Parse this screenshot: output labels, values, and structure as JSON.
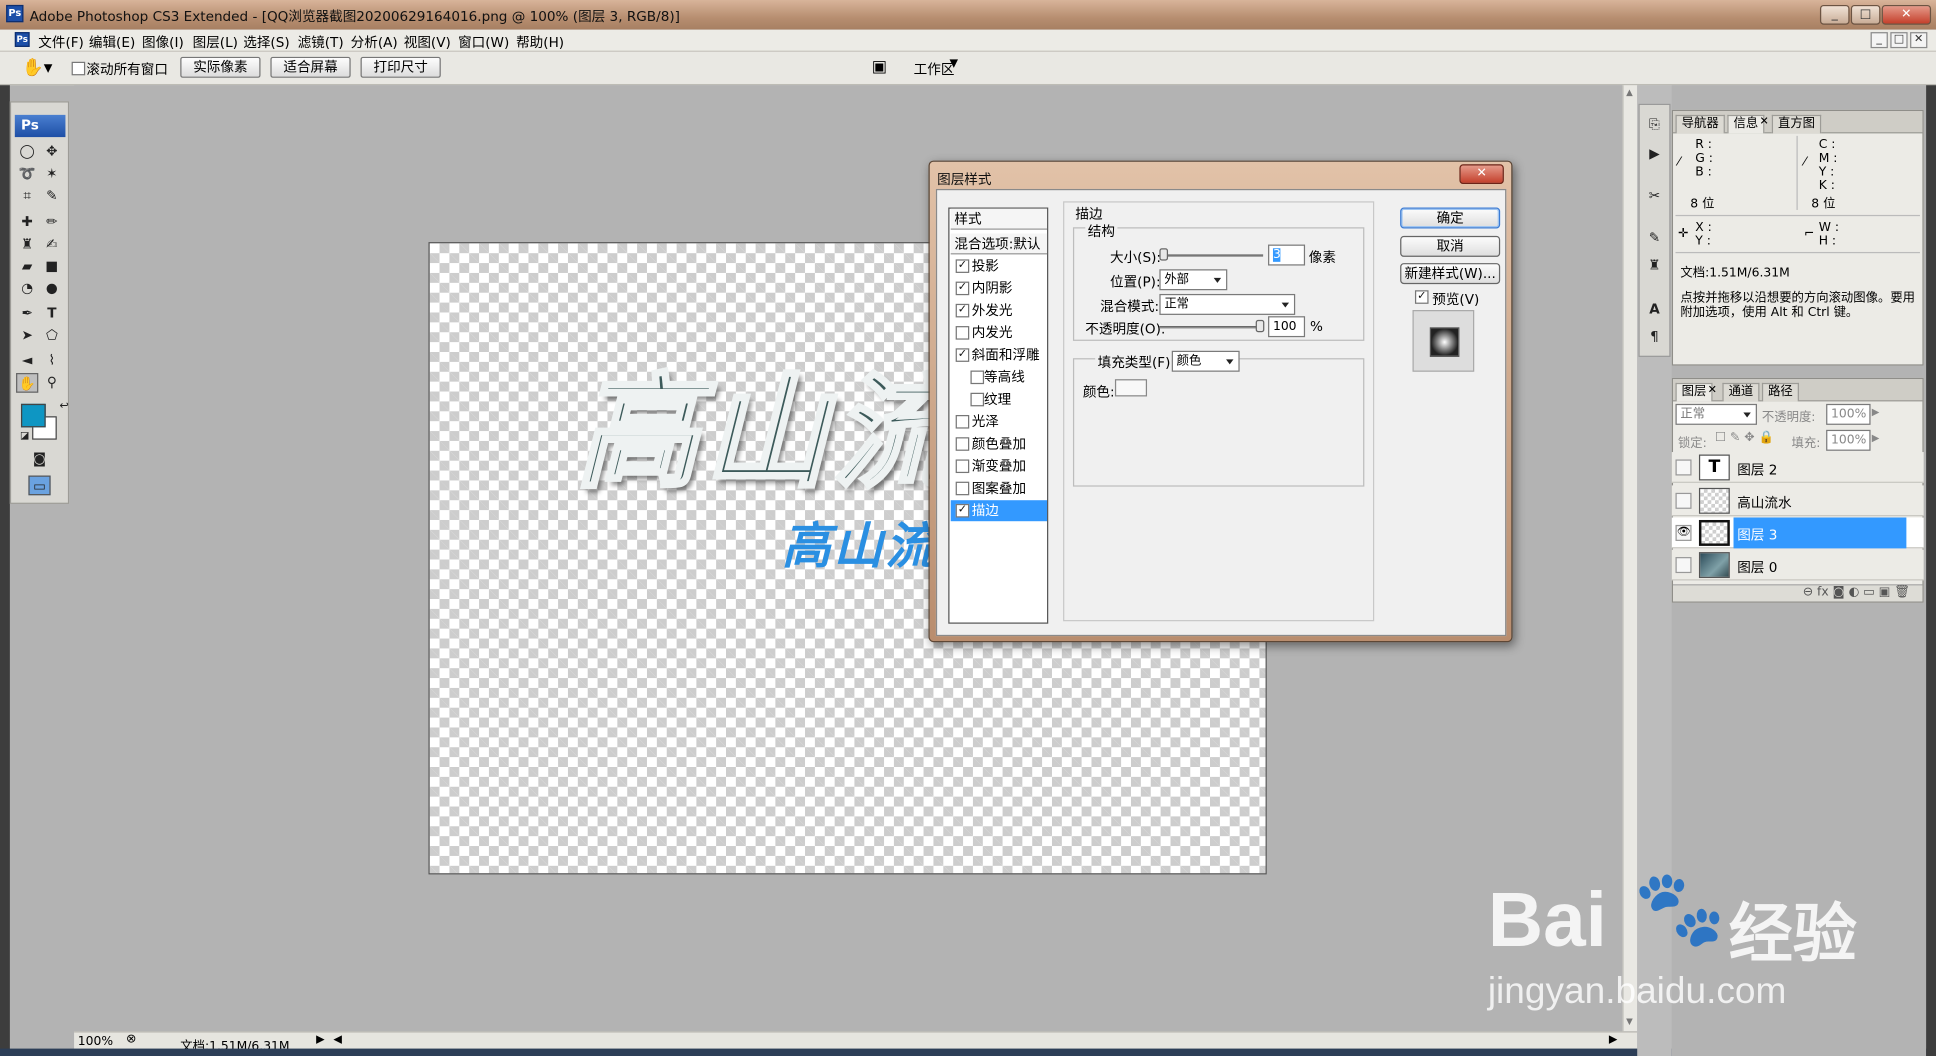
{
  "window": {
    "title": "Adobe Photoshop CS3 Extended - [QQ浏览器截图20200629164016.png @ 100% (图层 3, RGB/8)]",
    "app_icon": "Ps",
    "controls": [
      "_",
      "□",
      "✕"
    ]
  },
  "menu": {
    "items": [
      "文件(F)",
      "编辑(E)",
      "图像(I)",
      "图层(L)",
      "选择(S)",
      "滤镜(T)",
      "分析(A)",
      "视图(V)",
      "窗口(W)",
      "帮助(H)"
    ],
    "mdi_controls": [
      "_",
      "□",
      "✕"
    ]
  },
  "options": {
    "scroll_all": "滚动所有窗口",
    "buttons": [
      "实际像素",
      "适合屏幕",
      "打印尺寸"
    ],
    "workspace": "工作区"
  },
  "toolbox": {
    "logo": "Ps"
  },
  "canvas": {
    "main_text": "高山流",
    "sub_text": "高山流"
  },
  "status": {
    "zoom": "100%",
    "doc": "文档:1.51M/6.31M"
  },
  "info_panel": {
    "tabs": [
      "导航器",
      "信息",
      "直方图"
    ],
    "active_tab": "信息",
    "rgb_labels": [
      "R :",
      "G :",
      "B :"
    ],
    "cmyk_labels": [
      "C :",
      "M :",
      "Y :",
      "K :"
    ],
    "bits_left": "8 位",
    "bits_right": "8 位",
    "xy_labels": [
      "X :",
      "Y :"
    ],
    "wh_labels": [
      "W :",
      "H :"
    ],
    "doc": "文档:1.51M/6.31M",
    "hint": "点按并拖移以沿想要的方向滚动图像。要用附加选项，使用 Alt 和 Ctrl 键。"
  },
  "layers_panel": {
    "tabs": [
      "图层",
      "通道",
      "路径"
    ],
    "blend_mode": "正常",
    "opacity_label": "不透明度:",
    "opacity": "100%",
    "lock_label": "锁定:",
    "fill_label": "填充:",
    "fill": "100%",
    "layers": [
      {
        "name": "图层 2",
        "type": "text",
        "visible": false,
        "selected": false
      },
      {
        "name": "高山流水",
        "type": "image",
        "visible": false,
        "selected": false
      },
      {
        "name": "图层 3",
        "type": "image",
        "visible": true,
        "selected": true
      },
      {
        "name": "图层 0",
        "type": "photo",
        "visible": false,
        "selected": false
      }
    ]
  },
  "dialog": {
    "title": "图层样式",
    "styles_header": "样式",
    "blend_default": "混合选项:默认",
    "styles": [
      {
        "label": "投影",
        "checked": true,
        "indent": false
      },
      {
        "label": "内阴影",
        "checked": true,
        "indent": false
      },
      {
        "label": "外发光",
        "checked": true,
        "indent": false
      },
      {
        "label": "内发光",
        "checked": false,
        "indent": false
      },
      {
        "label": "斜面和浮雕",
        "checked": true,
        "indent": false
      },
      {
        "label": "等高线",
        "checked": false,
        "indent": true
      },
      {
        "label": "纹理",
        "checked": false,
        "indent": true
      },
      {
        "label": "光泽",
        "checked": false,
        "indent": false
      },
      {
        "label": "颜色叠加",
        "checked": false,
        "indent": false
      },
      {
        "label": "渐变叠加",
        "checked": false,
        "indent": false
      },
      {
        "label": "图案叠加",
        "checked": false,
        "indent": false
      },
      {
        "label": "描边",
        "checked": true,
        "indent": false,
        "selected": true
      }
    ],
    "section_title": "描边",
    "structure_title": "结构",
    "size_label": "大小(S):",
    "size_value": "3",
    "size_unit": "像素",
    "position_label": "位置(P):",
    "position_value": "外部",
    "blend_label": "混合模式:",
    "blend_value": "正常",
    "opacity_label": "不透明度(O):",
    "opacity_value": "100",
    "opacity_unit": "%",
    "fill_type_label": "填充类型(F):",
    "fill_type_value": "颜色",
    "color_label": "颜色:",
    "ok": "确定",
    "cancel": "取消",
    "new_style": "新建样式(W)...",
    "preview_label": "预览(V)",
    "preview_checked": true
  },
  "watermark": {
    "brand": "Bai",
    "brand2": "经验",
    "url": "jingyan.baidu.com"
  },
  "colors": {
    "accent": "#3399ff",
    "foreground": "#0e96c3",
    "subtext": "#2a8fe2"
  }
}
